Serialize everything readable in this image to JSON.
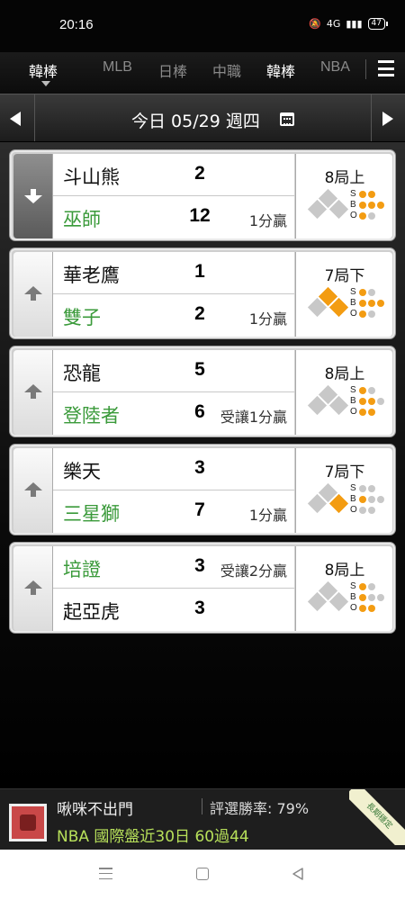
{
  "status_bar": {
    "time": "20:16",
    "battery": "47",
    "network_label": "4G"
  },
  "tabs": [
    {
      "label": "韓棒",
      "active": true
    },
    {
      "label": "MLB",
      "active": false
    },
    {
      "label": "日棒",
      "active": false
    },
    {
      "label": "中職",
      "active": false
    },
    {
      "label": "韓棒",
      "active": false
    },
    {
      "label": "NBA",
      "active": false
    }
  ],
  "date_bar": {
    "date_label": "今日 05/29 週四"
  },
  "games": [
    {
      "away": "斗山熊",
      "away_score": "2",
      "away_result": "",
      "home": "巫師",
      "home_score": "12",
      "home_result": "1分贏",
      "inning": "8局上",
      "favorite": true,
      "bases": {
        "first": false,
        "second": false,
        "third": false
      },
      "count": {
        "S": 2,
        "B": 3,
        "O": 1
      }
    },
    {
      "away": "華老鷹",
      "away_score": "1",
      "away_result": "",
      "home": "雙子",
      "home_score": "2",
      "home_result": "1分贏",
      "inning": "7局下",
      "favorite": false,
      "bases": {
        "first": true,
        "second": true,
        "third": false
      },
      "count": {
        "S": 1,
        "B": 3,
        "O": 1
      }
    },
    {
      "away": "恐龍",
      "away_score": "5",
      "away_result": "",
      "home": "登陸者",
      "home_score": "6",
      "home_result": "受讓1分贏",
      "inning": "8局上",
      "favorite": false,
      "bases": {
        "first": false,
        "second": false,
        "third": false
      },
      "count": {
        "S": 1,
        "B": 2,
        "O": 2
      }
    },
    {
      "away": "樂天",
      "away_score": "3",
      "away_result": "",
      "home": "三星獅",
      "home_score": "7",
      "home_result": "1分贏",
      "inning": "7局下",
      "favorite": false,
      "bases": {
        "first": true,
        "second": false,
        "third": false
      },
      "count": {
        "S": 0,
        "B": 1,
        "O": 0
      }
    },
    {
      "away": "培證",
      "away_score": "3",
      "away_result": "受讓2分贏",
      "home": "起亞虎",
      "home_score": "3",
      "home_result": "",
      "inning": "8局上",
      "favorite": false,
      "away_green": true,
      "bases": {
        "first": false,
        "second": false,
        "third": false
      },
      "count": {
        "S": 1,
        "B": 1,
        "O": 2
      }
    }
  ],
  "banner": {
    "name": "啾咪不出門",
    "win_rate": "評選勝率: 79%",
    "record": "NBA 國際盤近30日 60過44",
    "ribbon": "長期穩定"
  },
  "colors": {
    "accent": "#f39c12",
    "home_team": "#3a9a3a",
    "record": "#b7e05a"
  }
}
